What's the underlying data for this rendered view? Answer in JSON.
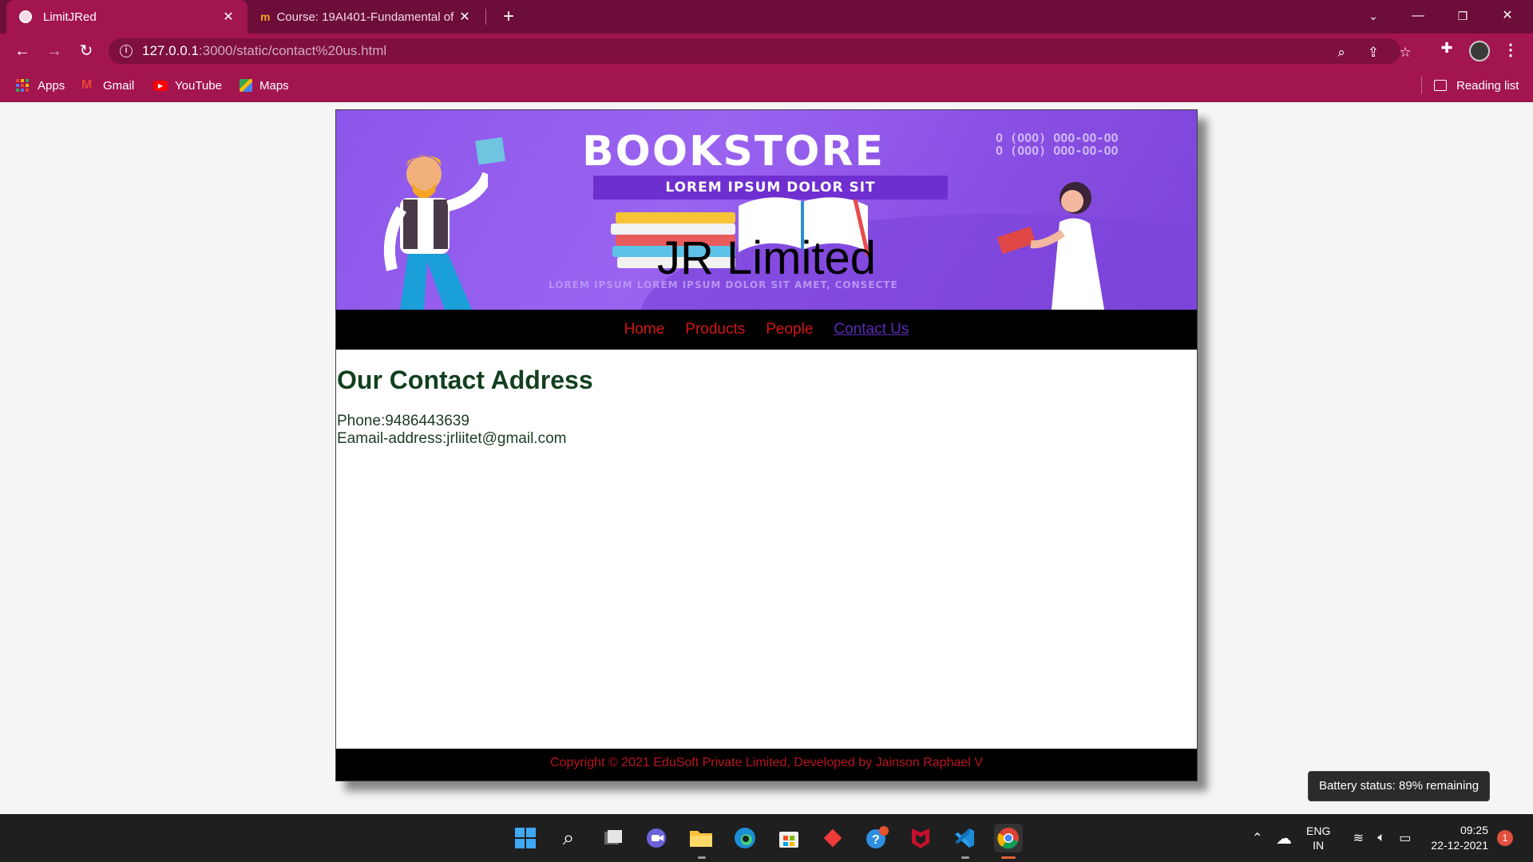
{
  "browser": {
    "tabs": [
      {
        "title": "LimitJRed",
        "active": true
      },
      {
        "title": "Course: 19AI401-Fundamental of",
        "active": false
      }
    ],
    "url_host": "127.0.0.1",
    "url_path": ":3000/static/contact%20us.html",
    "bookmarks": [
      {
        "label": "Apps",
        "icon": "apps-grid-icon"
      },
      {
        "label": "Gmail",
        "icon": "gmail-icon"
      },
      {
        "label": "YouTube",
        "icon": "youtube-icon"
      },
      {
        "label": "Maps",
        "icon": "maps-icon"
      }
    ],
    "reading_list": "Reading list",
    "theme_color": "#a3154f",
    "titlebar_color": "#6d0d3a"
  },
  "banner": {
    "store_title": "BOOKSTORE",
    "subtitle": "LOREM IPSUM DOLOR SIT",
    "phones": [
      "O (OOO) OOO-OO-OO",
      "O (OOO) OOO-OO-OO"
    ],
    "fine_print": "LOREM IPSUM LOREM IPSUM DOLOR SIT AMET, CONSECTE",
    "site_name": "JR Limited"
  },
  "nav": {
    "items": [
      "Home",
      "Products",
      "People",
      "Contact Us"
    ],
    "link_color": "#d31515"
  },
  "content": {
    "heading": "Our Contact Address",
    "phone_line": "Phone:9486443639",
    "email_line": "Eamail-address:jrliitet@gmail.com"
  },
  "footer": {
    "text": "Copyright © 2021 EduSoft Private Limited, Developed by Jainson Raphael V"
  },
  "tooltip": {
    "text": "Battery status: 89% remaining"
  },
  "taskbar": {
    "language": "ENG",
    "region": "IN",
    "time": "09:25",
    "date": "22-12-2021",
    "notifications": "1"
  }
}
